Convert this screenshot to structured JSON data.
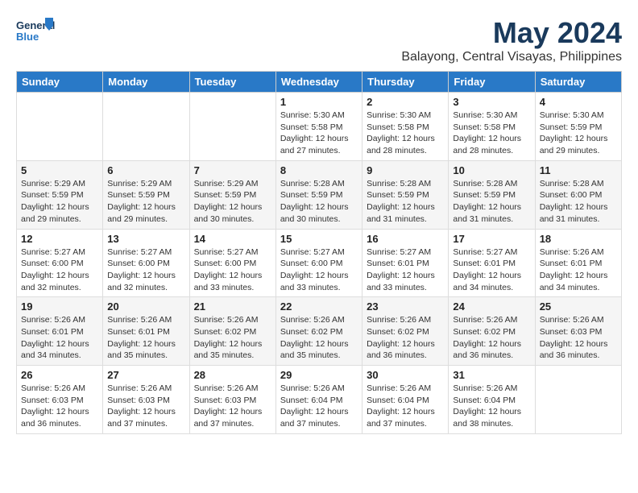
{
  "header": {
    "logo_line1": "General",
    "logo_line2": "Blue",
    "month": "May 2024",
    "location": "Balayong, Central Visayas, Philippines"
  },
  "weekdays": [
    "Sunday",
    "Monday",
    "Tuesday",
    "Wednesday",
    "Thursday",
    "Friday",
    "Saturday"
  ],
  "weeks": [
    [
      {
        "day": "",
        "info": ""
      },
      {
        "day": "",
        "info": ""
      },
      {
        "day": "",
        "info": ""
      },
      {
        "day": "1",
        "info": "Sunrise: 5:30 AM\nSunset: 5:58 PM\nDaylight: 12 hours\nand 27 minutes."
      },
      {
        "day": "2",
        "info": "Sunrise: 5:30 AM\nSunset: 5:58 PM\nDaylight: 12 hours\nand 28 minutes."
      },
      {
        "day": "3",
        "info": "Sunrise: 5:30 AM\nSunset: 5:58 PM\nDaylight: 12 hours\nand 28 minutes."
      },
      {
        "day": "4",
        "info": "Sunrise: 5:30 AM\nSunset: 5:59 PM\nDaylight: 12 hours\nand 29 minutes."
      }
    ],
    [
      {
        "day": "5",
        "info": "Sunrise: 5:29 AM\nSunset: 5:59 PM\nDaylight: 12 hours\nand 29 minutes."
      },
      {
        "day": "6",
        "info": "Sunrise: 5:29 AM\nSunset: 5:59 PM\nDaylight: 12 hours\nand 29 minutes."
      },
      {
        "day": "7",
        "info": "Sunrise: 5:29 AM\nSunset: 5:59 PM\nDaylight: 12 hours\nand 30 minutes."
      },
      {
        "day": "8",
        "info": "Sunrise: 5:28 AM\nSunset: 5:59 PM\nDaylight: 12 hours\nand 30 minutes."
      },
      {
        "day": "9",
        "info": "Sunrise: 5:28 AM\nSunset: 5:59 PM\nDaylight: 12 hours\nand 31 minutes."
      },
      {
        "day": "10",
        "info": "Sunrise: 5:28 AM\nSunset: 5:59 PM\nDaylight: 12 hours\nand 31 minutes."
      },
      {
        "day": "11",
        "info": "Sunrise: 5:28 AM\nSunset: 6:00 PM\nDaylight: 12 hours\nand 31 minutes."
      }
    ],
    [
      {
        "day": "12",
        "info": "Sunrise: 5:27 AM\nSunset: 6:00 PM\nDaylight: 12 hours\nand 32 minutes."
      },
      {
        "day": "13",
        "info": "Sunrise: 5:27 AM\nSunset: 6:00 PM\nDaylight: 12 hours\nand 32 minutes."
      },
      {
        "day": "14",
        "info": "Sunrise: 5:27 AM\nSunset: 6:00 PM\nDaylight: 12 hours\nand 33 minutes."
      },
      {
        "day": "15",
        "info": "Sunrise: 5:27 AM\nSunset: 6:00 PM\nDaylight: 12 hours\nand 33 minutes."
      },
      {
        "day": "16",
        "info": "Sunrise: 5:27 AM\nSunset: 6:01 PM\nDaylight: 12 hours\nand 33 minutes."
      },
      {
        "day": "17",
        "info": "Sunrise: 5:27 AM\nSunset: 6:01 PM\nDaylight: 12 hours\nand 34 minutes."
      },
      {
        "day": "18",
        "info": "Sunrise: 5:26 AM\nSunset: 6:01 PM\nDaylight: 12 hours\nand 34 minutes."
      }
    ],
    [
      {
        "day": "19",
        "info": "Sunrise: 5:26 AM\nSunset: 6:01 PM\nDaylight: 12 hours\nand 34 minutes."
      },
      {
        "day": "20",
        "info": "Sunrise: 5:26 AM\nSunset: 6:01 PM\nDaylight: 12 hours\nand 35 minutes."
      },
      {
        "day": "21",
        "info": "Sunrise: 5:26 AM\nSunset: 6:02 PM\nDaylight: 12 hours\nand 35 minutes."
      },
      {
        "day": "22",
        "info": "Sunrise: 5:26 AM\nSunset: 6:02 PM\nDaylight: 12 hours\nand 35 minutes."
      },
      {
        "day": "23",
        "info": "Sunrise: 5:26 AM\nSunset: 6:02 PM\nDaylight: 12 hours\nand 36 minutes."
      },
      {
        "day": "24",
        "info": "Sunrise: 5:26 AM\nSunset: 6:02 PM\nDaylight: 12 hours\nand 36 minutes."
      },
      {
        "day": "25",
        "info": "Sunrise: 5:26 AM\nSunset: 6:03 PM\nDaylight: 12 hours\nand 36 minutes."
      }
    ],
    [
      {
        "day": "26",
        "info": "Sunrise: 5:26 AM\nSunset: 6:03 PM\nDaylight: 12 hours\nand 36 minutes."
      },
      {
        "day": "27",
        "info": "Sunrise: 5:26 AM\nSunset: 6:03 PM\nDaylight: 12 hours\nand 37 minutes."
      },
      {
        "day": "28",
        "info": "Sunrise: 5:26 AM\nSunset: 6:03 PM\nDaylight: 12 hours\nand 37 minutes."
      },
      {
        "day": "29",
        "info": "Sunrise: 5:26 AM\nSunset: 6:04 PM\nDaylight: 12 hours\nand 37 minutes."
      },
      {
        "day": "30",
        "info": "Sunrise: 5:26 AM\nSunset: 6:04 PM\nDaylight: 12 hours\nand 37 minutes."
      },
      {
        "day": "31",
        "info": "Sunrise: 5:26 AM\nSunset: 6:04 PM\nDaylight: 12 hours\nand 38 minutes."
      },
      {
        "day": "",
        "info": ""
      }
    ]
  ]
}
